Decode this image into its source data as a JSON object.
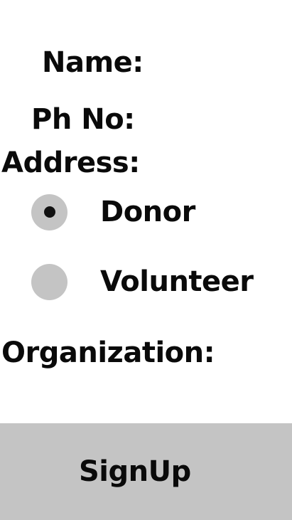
{
  "form": {
    "name_label": "Name:",
    "phone_label": "Ph No:",
    "address_label": "Address:",
    "organization_label": "Organization:"
  },
  "role_options": [
    {
      "label": "Donor",
      "selected": true
    },
    {
      "label": "Volunteer",
      "selected": false
    }
  ],
  "signup_button": {
    "label": "SignUp"
  },
  "colors": {
    "background": "#ffffff",
    "control_gray": "#c4c4c4",
    "text": "#0a0a0a"
  }
}
